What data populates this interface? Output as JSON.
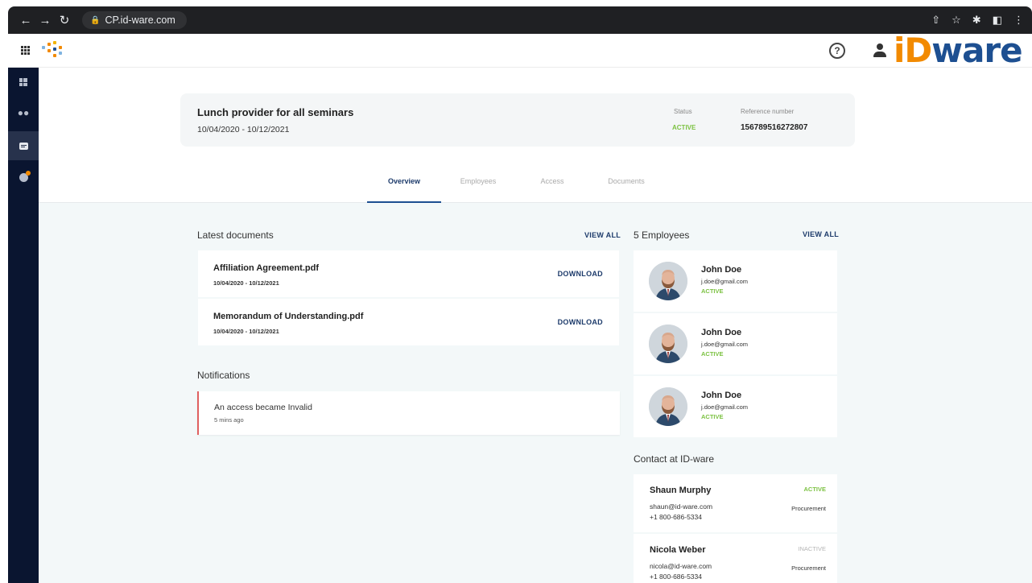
{
  "browser": {
    "url": "CP.id-ware.com",
    "icons": [
      "back-icon",
      "forward-icon",
      "reload-icon",
      "lock-icon",
      "share-icon",
      "star-icon",
      "extensions-icon",
      "sidepanel-icon",
      "menu-icon"
    ]
  },
  "header": {
    "help_glyph": "?",
    "brand_prefix": "iD",
    "brand_suffix": "ware",
    "brand_colors": {
      "orange": "#f28a00",
      "blue": "#1d4f91"
    }
  },
  "sidebar": {
    "items": [
      {
        "name": "dashboard",
        "icon": "dashboard-icon"
      },
      {
        "name": "people",
        "icon": "people-icon"
      },
      {
        "name": "documents",
        "icon": "document-icon",
        "active": true
      },
      {
        "name": "info",
        "icon": "info-icon"
      }
    ]
  },
  "project": {
    "title": "Lunch provider for all seminars",
    "dates": "10/04/2020 - 10/12/2021",
    "status_label": "Status",
    "status_value": "ACTIVE",
    "ref_label": "Reference number",
    "ref_value": "156789516272807"
  },
  "tabs": [
    {
      "label": "Overview",
      "active": true
    },
    {
      "label": "Employees"
    },
    {
      "label": "Access"
    },
    {
      "label": "Documents"
    }
  ],
  "documents": {
    "title": "Latest documents",
    "view_all": "VIEW ALL",
    "items": [
      {
        "name": "Affiliation Agreement.pdf",
        "dates": "10/04/2020 - 10/12/2021",
        "action": "DOWNLOAD"
      },
      {
        "name": "Memorandum of Understanding.pdf",
        "dates": "10/04/2020 - 10/12/2021",
        "action": "DOWNLOAD"
      }
    ]
  },
  "notifications": {
    "title": "Notifications",
    "items": [
      {
        "text": "An access became Invalid",
        "time": "5 mins ago"
      }
    ]
  },
  "employees": {
    "title": "5 Employees",
    "view_all": "VIEW ALL",
    "items": [
      {
        "name": "John Doe",
        "email": "j.doe@gmail.com",
        "status": "ACTIVE"
      },
      {
        "name": "John Doe",
        "email": "j.doe@gmail.com",
        "status": "ACTIVE"
      },
      {
        "name": "John Doe",
        "email": "j.doe@gmail.com",
        "status": "ACTIVE"
      }
    ]
  },
  "contacts": {
    "title": "Contact at ID-ware",
    "items": [
      {
        "name": "Shaun Murphy",
        "status": "ACTIVE",
        "email": "shaun@id-ware.com",
        "phone": "+1 800-686-5334",
        "dept": "Procurement",
        "status_color": "#7cc242"
      },
      {
        "name": "Nicola Weber",
        "status": "INACTIVE",
        "email": "nicola@id-ware.com",
        "phone": "+1 800-686-5334",
        "dept": "Procurement",
        "status_color": "#b5b5b5"
      }
    ]
  }
}
